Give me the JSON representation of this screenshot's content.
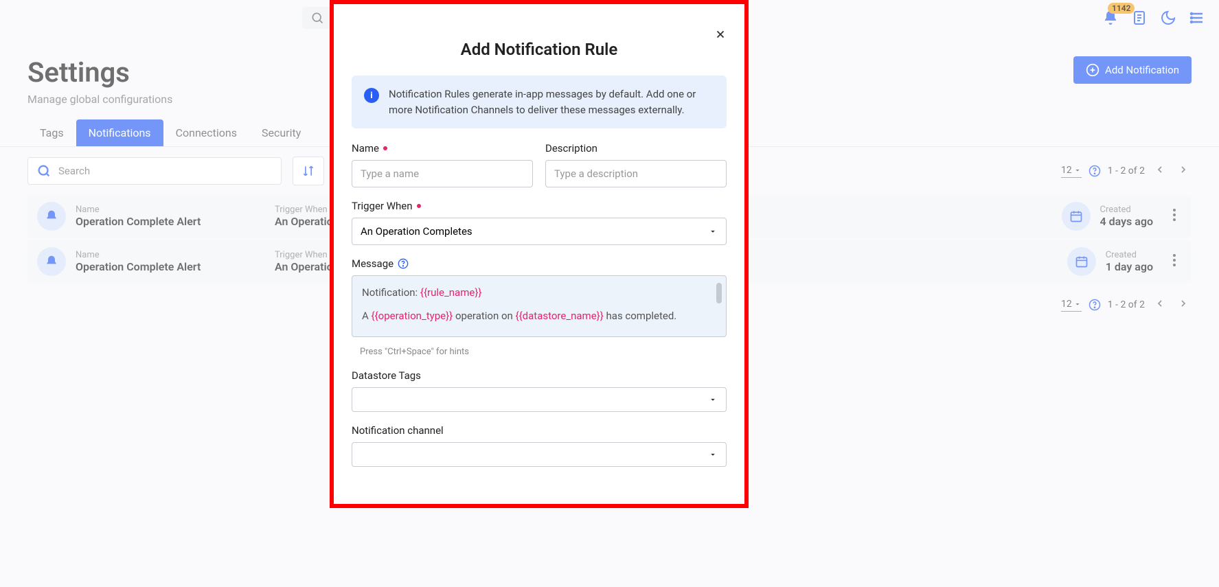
{
  "topbar": {
    "search_placeholder": "Search",
    "notification_count": "1142"
  },
  "page": {
    "title": "Settings",
    "subtitle": "Manage global configurations",
    "add_button": "Add Notification"
  },
  "tabs": [
    "Tags",
    "Notifications",
    "Connections",
    "Security"
  ],
  "toolbar": {
    "search_placeholder": "Search",
    "page_size": "12",
    "range": "1 - 2 of 2"
  },
  "columns": {
    "name_label": "Name",
    "trigger_label": "Trigger When",
    "created_label": "Created"
  },
  "rows": [
    {
      "name": "Operation Complete Alert",
      "trigger": "An Operation Completes",
      "created": "4 days ago"
    },
    {
      "name": "Operation Complete Alert",
      "trigger": "An Operation Completes",
      "created": "1 day ago"
    }
  ],
  "modal": {
    "title": "Add Notification Rule",
    "info": "Notification Rules generate in-app messages by default. Add one or more Notification Channels to deliver these messages externally.",
    "labels": {
      "name": "Name",
      "description": "Description",
      "trigger": "Trigger When",
      "message": "Message",
      "datastore_tags": "Datastore Tags",
      "channel": "Notification channel"
    },
    "placeholders": {
      "name": "Type a name",
      "description": "Type a description"
    },
    "trigger_value": "An Operation Completes",
    "message_parts": {
      "p1": "Notification: ",
      "v1": "{{rule_name}}",
      "p2": "A ",
      "v2": "{{operation_type}}",
      "p3": " operation on ",
      "v3": "{{datastore_name}}",
      "p4": " has completed."
    },
    "hint": "Press \"Ctrl+Space\" for hints"
  }
}
